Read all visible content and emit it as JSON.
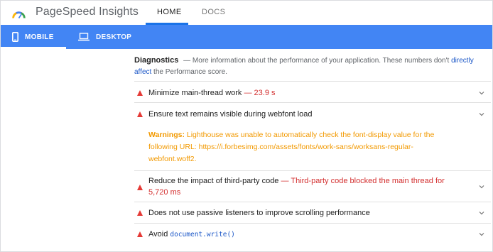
{
  "header": {
    "brand": "PageSpeed Insights",
    "logo_icon": "pagespeed-gauge-icon",
    "tabs": [
      "HOME",
      "DOCS"
    ],
    "active_tab": "HOME"
  },
  "device_bar": {
    "mobile_label": "MOBILE",
    "desktop_label": "DESKTOP",
    "active": "MOBILE",
    "color": "#4285f4"
  },
  "diagnostics": {
    "title": "Diagnostics",
    "dash": "—",
    "desc_before": "More information about the performance of your application. These numbers don't ",
    "link_text_1": "directly",
    "link_text_2": "affect",
    "desc_after": " the Performance score."
  },
  "audits": [
    {
      "title": "Minimize main-thread work",
      "value": "— 23.9 s"
    },
    {
      "title": "Ensure text remains visible during webfont load",
      "value": "",
      "warning_label": "Warnings:",
      "warning_text": " Lighthouse was unable to automatically check the font-display value for the following URL: https://i.forbesimg.com/assets/fonts/work-sans/worksans-regular-webfont.woff2."
    },
    {
      "title": "Reduce the impact of third-party code",
      "value": "— Third-party code blocked the main thread for 5,720 ms"
    },
    {
      "title": "Does not use passive listeners to improve scrolling performance",
      "value": ""
    },
    {
      "title": "Avoid",
      "code": "document.write()"
    }
  ],
  "colors": {
    "fail": "#e53935",
    "warning": "#f29900",
    "link": "#1a56c7"
  }
}
